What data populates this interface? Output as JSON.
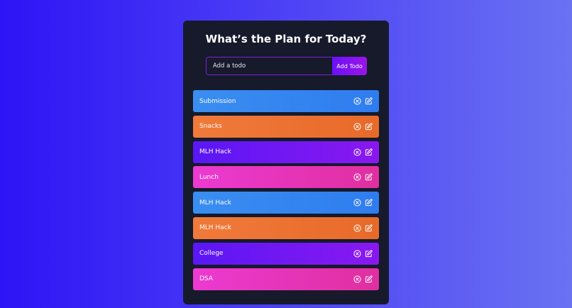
{
  "app": {
    "title": "What’s the Plan for Today?"
  },
  "form": {
    "placeholder": "Add a todo",
    "value": "",
    "button_label": "Add Todo"
  },
  "todos": [
    {
      "label": "Submission",
      "color": "#3a8ef0"
    },
    {
      "label": "Snacks",
      "color": "#f07a3a"
    },
    {
      "label": "MLH Hack",
      "color": "#5a17f5"
    },
    {
      "label": "Lunch",
      "color": "#ec3ad2"
    },
    {
      "label": "MLH Hack",
      "color": "#3a8ef0"
    },
    {
      "label": "MLH Hack",
      "color": "#f07a3a"
    },
    {
      "label": "College",
      "color": "#5a17f5"
    },
    {
      "label": "DSA",
      "color": "#ec3ad2"
    }
  ],
  "icons": {
    "delete": "close-circle-icon",
    "edit": "edit-icon"
  }
}
